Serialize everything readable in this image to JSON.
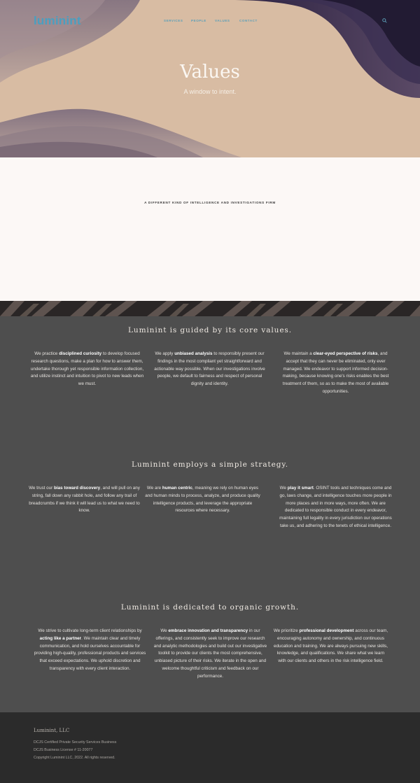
{
  "header": {
    "logo": "luminint",
    "nav": [
      "SERVICES",
      "PEOPLE",
      "VALUES",
      "CONTACT"
    ]
  },
  "hero": {
    "title": "Values",
    "subtitle": "A window to intent."
  },
  "intro": {
    "tagline": "A DIFFERENT KIND OF INTELLIGENCE AND INVESTIGATIONS FIRM"
  },
  "sections": [
    {
      "title": "Luminint is guided by its core values.",
      "columns": [
        {
          "pre": "We practice ",
          "bold": "disciplined curiosity",
          "post": " to develop focused research questions, make a plan for how to answer them, undertake thorough yet responsible information collection, and utilize instinct and intuition to pivot to new leads when we must."
        },
        {
          "pre": "We apply ",
          "bold": "unbiased analysis",
          "post": " to responsibly present our findings in the most compliant yet straightforward and actionable way possible. When our investigations involve people, we default to fairness and respect of personal dignity and identity."
        },
        {
          "pre": "We maintain a ",
          "bold": "clear-eyed perspective of risks",
          "post": ", and accept that they can never be eliminated, only ever managed. We endeavor to support informed decision-making, because knowing one's risks enables the best treatment of them, so as to make the most of available opportunities."
        }
      ]
    },
    {
      "title": "Luminint employs a simple strategy.",
      "columns": [
        {
          "pre": "We trust our ",
          "bold": "bias toward discovery",
          "post": ", and will pull on any string, fall down any rabbit hole, and follow any trail of breadcrumbs if we think it will lead us to what we need to know."
        },
        {
          "pre": "We are ",
          "bold": "human centric",
          "post": ", meaning we rely on human eyes and human minds to process, analyze, and produce quality intelligence products, and leverage the appropriate resources where necessary."
        },
        {
          "pre": "We ",
          "bold": "play it smart",
          "post": ". OSINT tools and techniques come and go, laws change, and intelligence touches more people in more places and in more ways, more often. We are dedicated to responsible conduct in every endeavor, maintaining full legality in every jurisdiction our operations take us, and adhering to the tenets of ethical intelligence."
        }
      ]
    },
    {
      "title": "Luminint is dedicated to organic growth.",
      "columns": [
        {
          "pre": "We strive to cultivate long-term client relationships by ",
          "bold": "acting like a partner",
          "post": ". We maintain clear and timely communication, and hold ourselves accountable for providing high-quality, professional products and services that exceed expectations. We uphold discretion and transparency with every client interaction."
        },
        {
          "pre": "We ",
          "bold": "embrace innovation and transparency",
          "post": " in our offerings, and consistently seek to improve our research and analytic methodologies and build out our investigative toolkit to provide our clients the most comprehensive, unbiased picture of their risks. We iterate in the open and welcome thoughtful criticism and feedback on our performance."
        },
        {
          "pre": "We prioritize ",
          "bold": "professional development",
          "post": " across our team, encouraging autonomy and ownership, and continuous education and training. We are always pursuing new skills, knowledge, and qualifications. We share what we learn with our clients and others in the risk intelligence field."
        }
      ]
    }
  ],
  "footer": {
    "company": "Luminint, LLC",
    "lines": [
      "DCJS Certified Private Security Services Business",
      "DCJS Business License # 11-20077",
      "Copyright Luminint LLC, 2022.  All rights reserved."
    ]
  },
  "colors": {
    "hero_bg": "#d8bca3",
    "accent": "#4a9fc0",
    "dark_bg": "#4e4e4e",
    "footer_bg": "#2b2b2b"
  }
}
